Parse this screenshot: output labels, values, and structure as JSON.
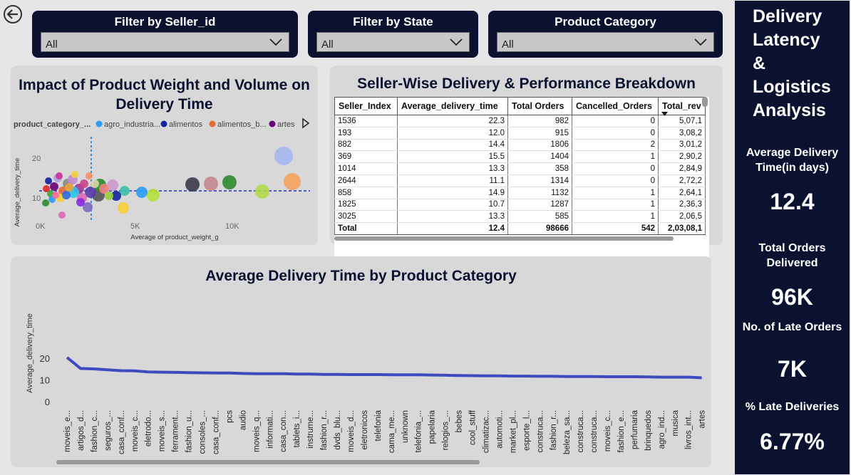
{
  "filters": [
    {
      "title": "Filter by Seller_id",
      "value": "All"
    },
    {
      "title": "Filter by State",
      "value": "All"
    },
    {
      "title": "Product Category",
      "value": "All"
    }
  ],
  "scatter": {
    "title_line1": "Impact of Product Weight and Volume on",
    "title_line2": "Delivery Time",
    "legend_title": "product_category_...",
    "legend_items": [
      {
        "label": "agro_industria...",
        "color": "#2e9cf4"
      },
      {
        "label": "alimentos",
        "color": "#12239e"
      },
      {
        "label": "alimentos_b...",
        "color": "#e66c37"
      },
      {
        "label": "artes",
        "color": "#6b007b"
      }
    ],
    "xlabel": "Average of product_weight_g",
    "ylabel": "Average_delivery_time",
    "x_ticks": [
      "0K",
      "5K",
      "10K"
    ],
    "y_ticks": [
      "20",
      "10"
    ]
  },
  "table": {
    "title": "Seller-Wise Delivery & Performance Breakdown",
    "columns": [
      "Seller_Index",
      "Average_delivery_time",
      "Total Orders",
      "Cancelled_Orders",
      "Total_rev"
    ],
    "rows": [
      [
        "1536",
        "22.3",
        "982",
        "0",
        "5,07,1"
      ],
      [
        "193",
        "12.0",
        "915",
        "0",
        "3,08,2"
      ],
      [
        "882",
        "14.4",
        "1806",
        "2",
        "3,01,2"
      ],
      [
        "369",
        "15.5",
        "1404",
        "1",
        "2,90,2"
      ],
      [
        "1014",
        "13.3",
        "358",
        "0",
        "2,84,9"
      ],
      [
        "2644",
        "11.1",
        "1314",
        "0",
        "2,72,2"
      ],
      [
        "858",
        "14.9",
        "1132",
        "1",
        "2,64,1"
      ],
      [
        "1825",
        "10.7",
        "1287",
        "1",
        "2,36,3"
      ],
      [
        "3025",
        "13.3",
        "585",
        "1",
        "2,06,5"
      ]
    ],
    "total": [
      "Total",
      "12.4",
      "98666",
      "542",
      "2,03,08,1"
    ]
  },
  "chart_data": {
    "type": "line",
    "title": "Average Delivery Time by Product Category",
    "ylabel": "Average_delivery_time",
    "xlabel": "",
    "ylim": [
      0,
      22
    ],
    "y_ticks": [
      0,
      10,
      20
    ],
    "categories": [
      "moveis_e...",
      "artigos_d...",
      "fashion_c...",
      "seguros_...",
      "casa_conf...",
      "moveis_c...",
      "eletrodo...",
      "moveis_s...",
      "ferrament...",
      "fashion_u...",
      "consoles_...",
      "casa_conf...",
      "pcs",
      "audio",
      "moveis_q...",
      "informati...",
      "casa_con...",
      "tablets_i...",
      "instrume...",
      "fashion_r...",
      "dvds_blu...",
      "moveis_d...",
      "eletronicos",
      "telefonia",
      "cama_me...",
      "unknown",
      "telefonia_...",
      "papelaria",
      "relogios_...",
      "bebes",
      "cool_stuff",
      "climatizac...",
      "automoti...",
      "market_pl...",
      "esporte_l...",
      "construca...",
      "fashion_r...",
      "beleza_sa...",
      "construca...",
      "construca...",
      "moveis_c...",
      "fashion_e...",
      "perfumaria",
      "brinquedos",
      "agro_ind...",
      "musica",
      "livros_int...",
      "artes"
    ],
    "values": [
      20.7,
      15.6,
      15.4,
      15.0,
      14.6,
      14.5,
      14.0,
      13.9,
      13.8,
      13.7,
      13.6,
      13.5,
      13.5,
      13.3,
      13.2,
      13.2,
      13.2,
      13.0,
      13.0,
      12.9,
      12.9,
      12.8,
      12.8,
      12.8,
      12.7,
      12.7,
      12.7,
      12.6,
      12.5,
      12.4,
      12.3,
      12.2,
      12.2,
      12.1,
      12.1,
      12.0,
      12.0,
      11.9,
      11.9,
      11.9,
      11.8,
      11.8,
      11.8,
      11.7,
      11.6,
      11.6,
      11.6,
      11.3
    ],
    "series": [
      {
        "values_ref": "values",
        "color": "#3e4bbf"
      }
    ]
  },
  "kpi": {
    "heading": [
      "Delivery",
      "Latency",
      "&",
      "Logistics",
      "Analysis"
    ],
    "avg_label_1": "Average Delivery",
    "avg_label_2": "Time(in days)",
    "avg_value": "12.4",
    "orders_label_1": "Total Orders",
    "orders_label_2": "Delivered",
    "orders_value": "96K",
    "late_label": "No. of Late Orders",
    "late_value": "7K",
    "pct_label": "% Late Deliveries",
    "pct_value": "6.77%"
  }
}
